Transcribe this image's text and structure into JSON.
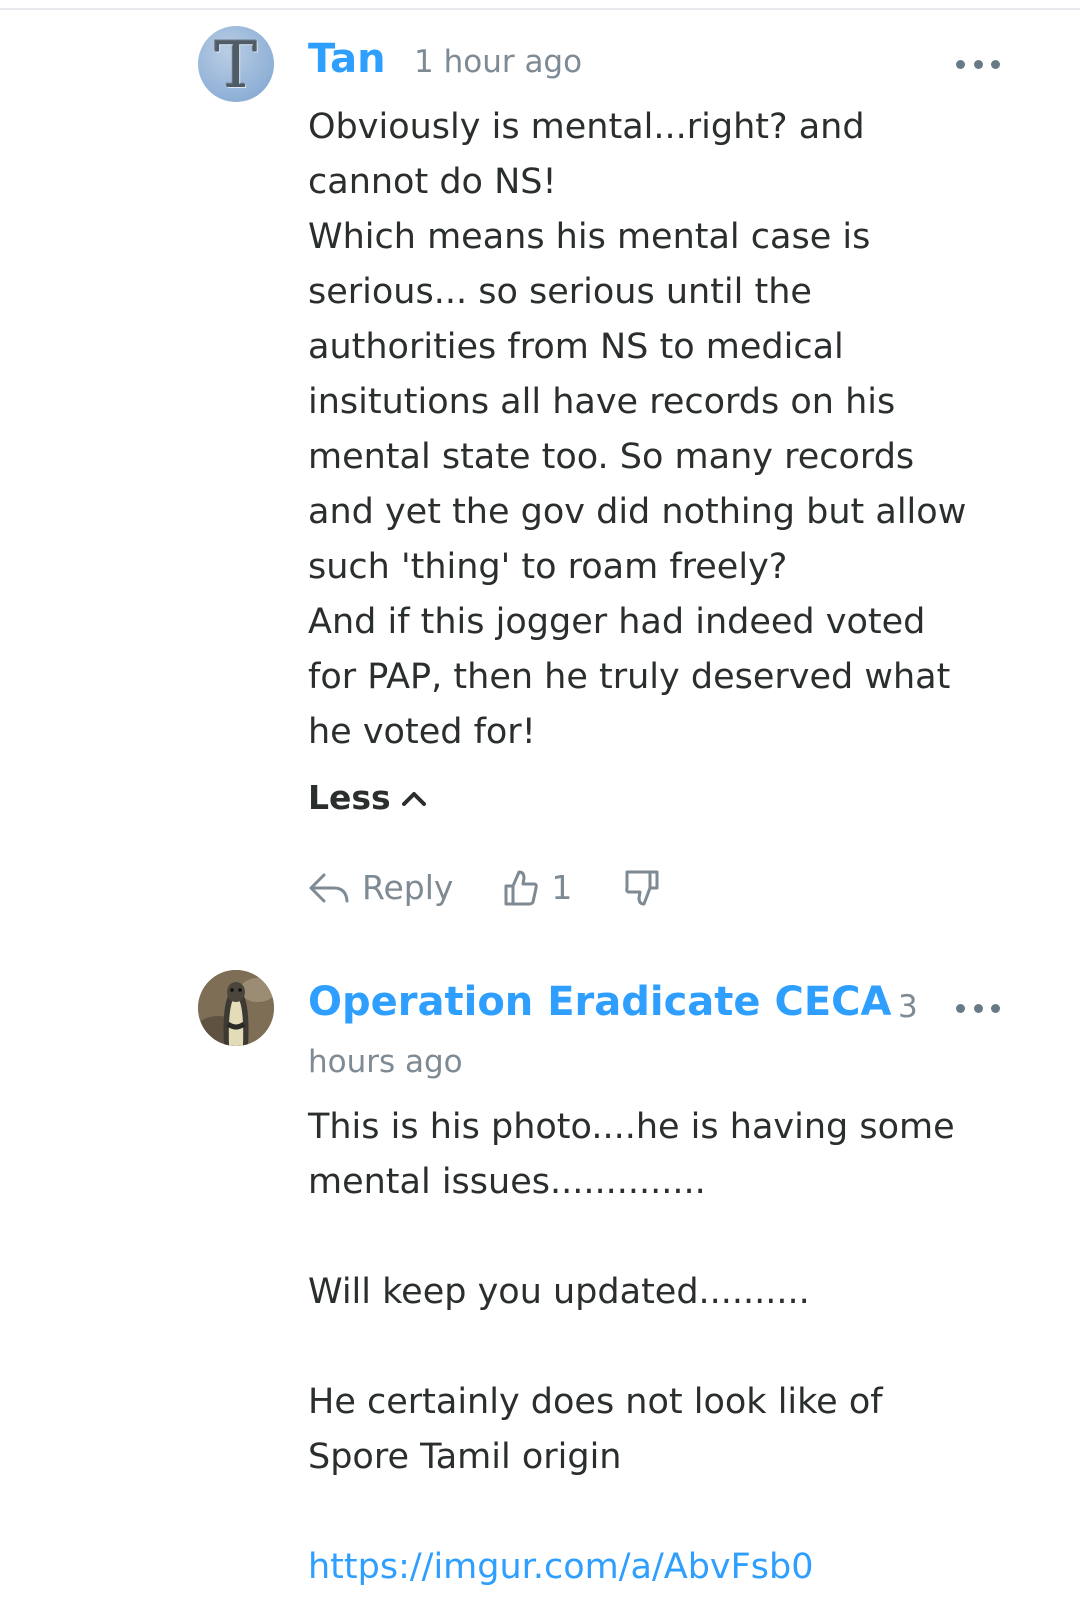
{
  "comments": [
    {
      "author": "Tan",
      "avatar_letter": "T",
      "timestamp": "1 hour ago",
      "body": "Obviously is mental...right? and\ncannot do NS!\nWhich means his mental case is\nserious... so serious until the\nauthorities from NS to medical\ninsitutions all have records on his\nmental state too. So many records\nand yet the gov did nothing but allow\nsuch 'thing' to roam freely?\nAnd if this jogger had indeed voted\nfor PAP, then he truly deserved what\nhe voted for!",
      "less_label": "Less",
      "reply_label": "Reply",
      "upvotes": "1"
    },
    {
      "author": "Operation Eradicate CECA",
      "timestamp_line1": "3",
      "timestamp_line2": "hours ago",
      "body": "This is his photo....he is having some\nmental issues..............\n\nWill keep you updated..........\n\nHe certainly does not look like of\nSpore Tamil origin",
      "link": "https://imgur.com/a/AbvFsb0"
    }
  ],
  "colors": {
    "author": "#2e9fff",
    "text": "#2a2e2e",
    "muted": "#7e8a94",
    "link": "#2e9fff"
  },
  "icons": [
    "more-dots-icon",
    "chevron-up-icon",
    "reply-arrow-icon",
    "thumbs-up-icon",
    "thumbs-down-icon"
  ]
}
